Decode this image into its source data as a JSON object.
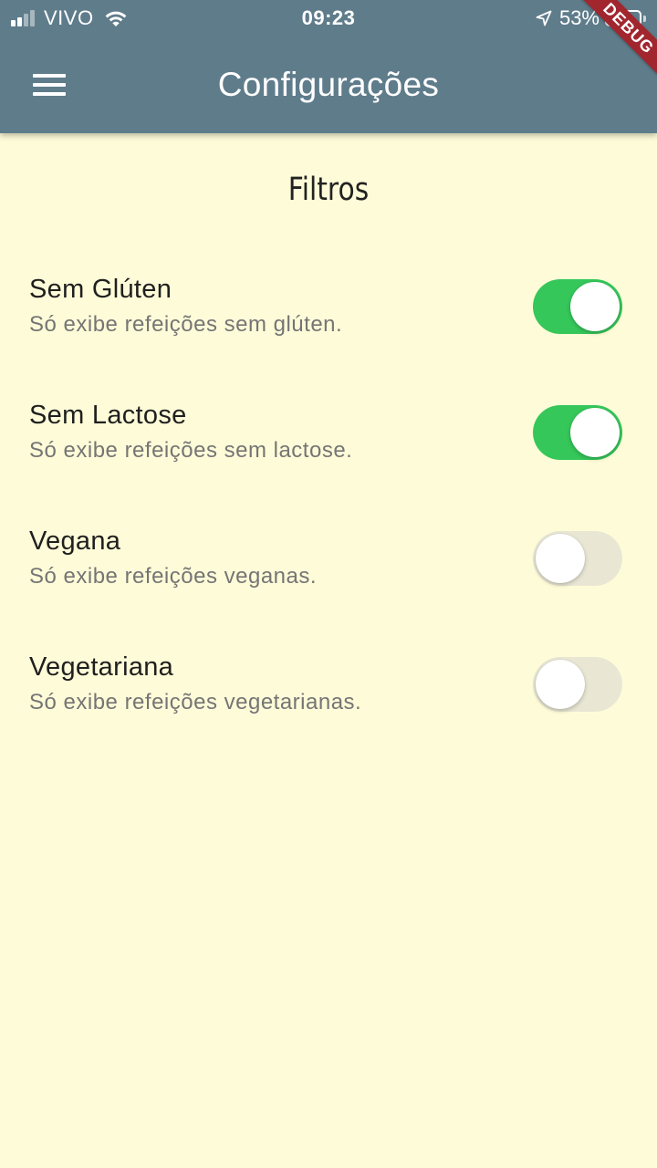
{
  "status_bar": {
    "carrier": "VIVO",
    "time": "09:23",
    "battery_percent": "53%",
    "battery_level": 0.53,
    "signal_bars_filled": 2,
    "signal_bars_total": 4,
    "icons": [
      "signal-icon",
      "wifi-icon",
      "location-arrow-icon",
      "battery-icon"
    ]
  },
  "app_bar": {
    "title": "Configurações",
    "menu_icon": "hamburger-icon",
    "background_color": "#5F7C8B",
    "debug_banner": "DEBUG"
  },
  "page": {
    "background_color": "#FEFCD8",
    "section_title": "Filtros"
  },
  "filters": [
    {
      "title": "Sem Glúten",
      "subtitle": "Só exibe refeições sem glúten.",
      "enabled": true
    },
    {
      "title": "Sem Lactose",
      "subtitle": "Só exibe refeições sem lactose.",
      "enabled": true
    },
    {
      "title": "Vegana",
      "subtitle": "Só exibe refeições veganas.",
      "enabled": false
    },
    {
      "title": "Vegetariana",
      "subtitle": "Só exibe refeições vegetarianas.",
      "enabled": false
    }
  ],
  "colors": {
    "switch_on": "#35C75A",
    "switch_off": "#E9E7D4",
    "debug_ribbon": "#A1262E"
  }
}
